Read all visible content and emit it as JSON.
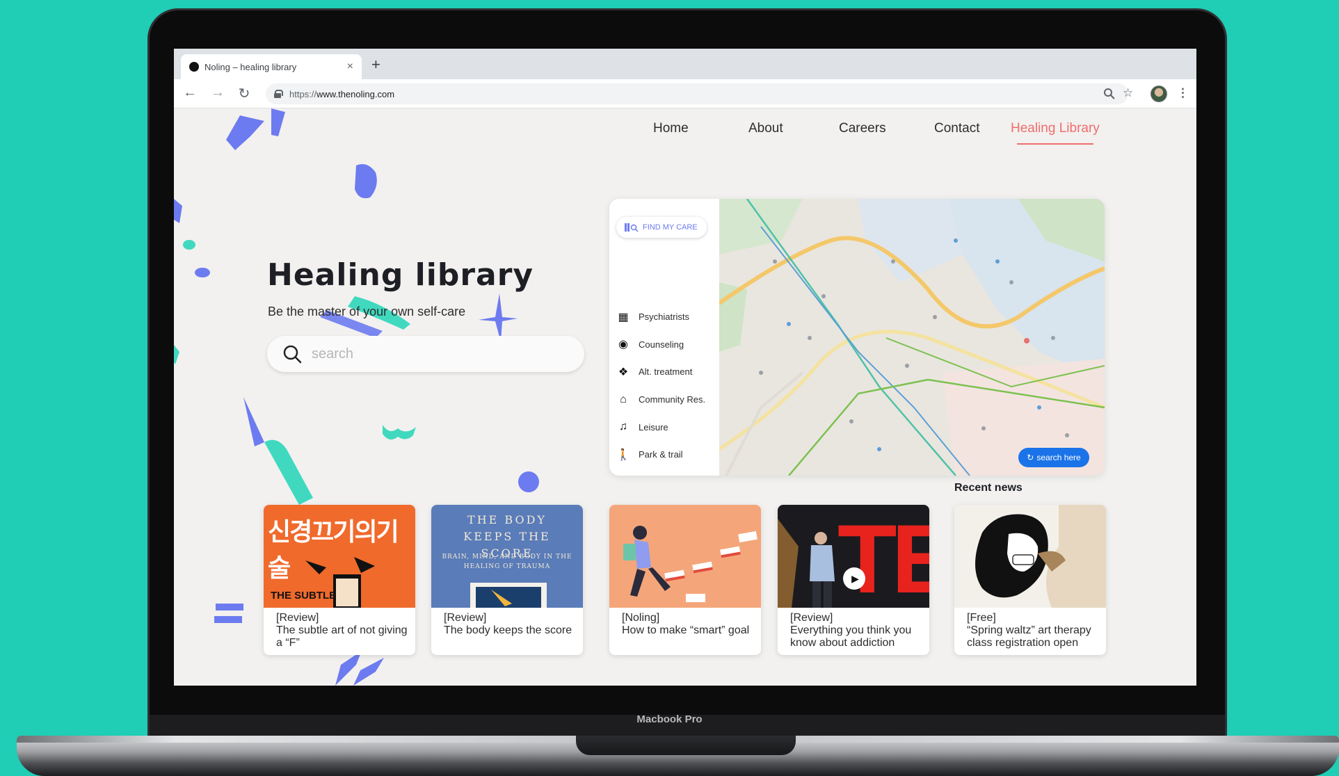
{
  "device": {
    "label": "Macbook Pro"
  },
  "browser": {
    "tab_title": "Noling – healing library",
    "url_prefix": "https://",
    "url_host": "www.thenoling.com"
  },
  "nav": {
    "home": "Home",
    "about": "About",
    "careers": "Careers",
    "contact": "Contact",
    "healing_library": "Healing Library"
  },
  "hero": {
    "title": "Healing library",
    "subtitle": "Be the master of your own self-care",
    "search_placeholder": "search"
  },
  "care": {
    "find_label": "FIND MY CARE",
    "items": [
      {
        "label": "Psychiatrists",
        "icon": "hospital-icon"
      },
      {
        "label": "Counseling",
        "icon": "head-icon"
      },
      {
        "label": "Alt. treatment",
        "icon": "paw-icon"
      },
      {
        "label": "Community Res.",
        "icon": "community-icon"
      },
      {
        "label": "Leisure",
        "icon": "leisure-icon"
      },
      {
        "label": "Park & trail",
        "icon": "walking-icon"
      }
    ],
    "map_button": "search here"
  },
  "recent_news_label": "Recent news",
  "cards": [
    {
      "tag": "[Review]",
      "title": "The subtle art of not giving a “F”",
      "image_text": "신경끄기의기술",
      "image_sub": "THE SUBTLE"
    },
    {
      "tag": "[Review]",
      "title": "The body keeps the score",
      "image_text": "THE BODY KEEPS THE SCORE",
      "image_sub": "BRAIN, MIND, AND BODY IN THE HEALING OF TRAUMA"
    },
    {
      "tag": "[Noling]",
      "title": "How to make “smart” goal",
      "image_text": "",
      "image_sub": ""
    },
    {
      "tag": "[Review]",
      "title": "Everything you think you know about addiction",
      "image_text": "TE",
      "image_sub": ""
    },
    {
      "tag": "[Free]",
      "title": "“Spring waltz” art therapy class registration open",
      "image_text": "",
      "image_sub": ""
    }
  ],
  "colors": {
    "background": "#20cdb5",
    "accent_nav": "#f06d6d",
    "brand_blue": "#6d7bf0",
    "brand_teal": "#40d9bf",
    "map_button": "#1a73e8"
  }
}
